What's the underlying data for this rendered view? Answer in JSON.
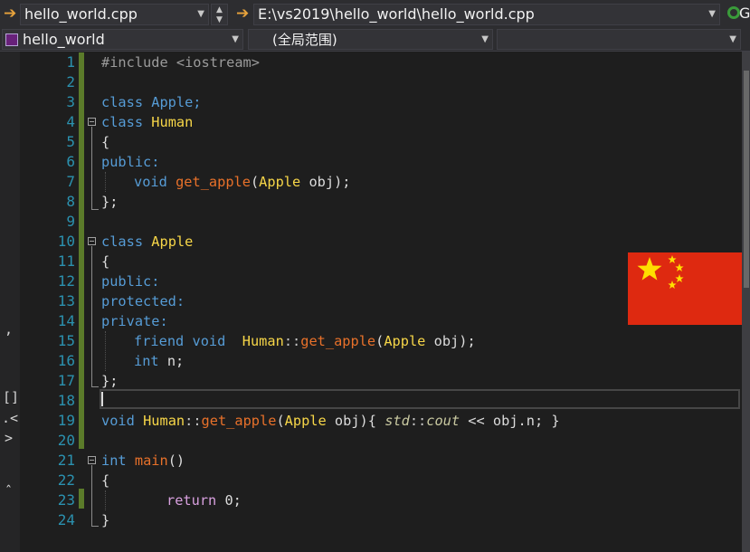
{
  "toolbar": {
    "file_combo": "hello_world.cpp",
    "path_combo": "E:\\vs2019\\hello_world\\hello_world.cpp",
    "right_cut": "G"
  },
  "navbar": {
    "project_combo": "hello_world",
    "scope_combo": "(全局范围)",
    "member_combo": ""
  },
  "left_panel": {
    "stray_chars": [
      ",",
      "[]",
      ".<",
      ">",
      "ˆ"
    ]
  },
  "editor": {
    "line_numbers": [
      "1",
      "2",
      "3",
      "4",
      "5",
      "6",
      "7",
      "8",
      "9",
      "10",
      "11",
      "12",
      "13",
      "14",
      "15",
      "16",
      "17",
      "18",
      "19",
      "20",
      "21",
      "22",
      "23",
      "24"
    ],
    "lines": {
      "l1": "#include <iostream>",
      "l3": "class Apple;",
      "l4a": "class",
      "l4b": "Human",
      "l5": "{",
      "l6": "public:",
      "l7a": "void",
      "l7b": "get_apple",
      "l7c": "(",
      "l7d": "Apple",
      "l7e": " obj);",
      "l8": "};",
      "l10a": "class",
      "l10b": "Apple",
      "l11": "{",
      "l12": "public:",
      "l13": "protected:",
      "l14": "private:",
      "l15a": "friend",
      "l15b": "void",
      "l15c": "Human",
      "l15d": "::",
      "l15e": "get_apple",
      "l15f": "(",
      "l15g": "Apple",
      "l15h": " obj);",
      "l16a": "int",
      "l16b": " n;",
      "l17": "};",
      "l19a": "void",
      "l19b": "Human",
      "l19c": "::",
      "l19d": "get_apple",
      "l19e": "(",
      "l19f": "Apple",
      "l19g": " obj){ ",
      "l19h": "std",
      "l19i": "::",
      "l19j": "cout",
      "l19k": " << obj.n; }",
      "l21a": "int",
      "l21b": "main",
      "l21c": "()",
      "l22": "{",
      "l23a": "return",
      "l23b": " 0;",
      "l24": "}"
    }
  },
  "colors": {
    "keyword": "#569cd6",
    "type": "#f7d648",
    "function": "#e8712a",
    "line_number": "#2b91af",
    "flag_red": "#de2910",
    "flag_star": "#ffde00"
  }
}
